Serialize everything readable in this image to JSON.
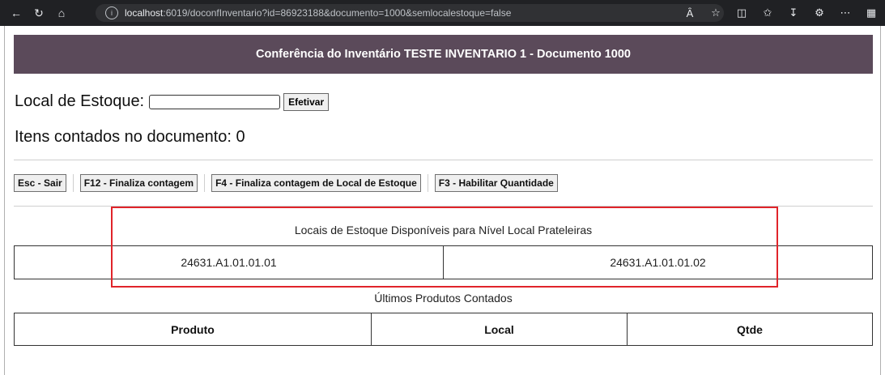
{
  "browser": {
    "url_host": "localhost",
    "url_rest": ":6019/doconfInventario?id=86923188&documento=1000&semlocalestoque=false",
    "icons": [
      "back-icon",
      "refresh-icon",
      "home-icon",
      "info-icon",
      "read-aloud-icon",
      "favorite-star-icon",
      "split-screen-icon",
      "favorites-icon",
      "download-icon",
      "extensions-icon",
      "more-icon",
      "sidebar-icon"
    ]
  },
  "header": {
    "title": "Conferência do Inventário TESTE INVENTARIO 1 - Documento 1000"
  },
  "local": {
    "label": "Local de Estoque:",
    "input_value": "",
    "efetivar_label": "Efetivar"
  },
  "itens": {
    "text": "Itens contados no documento: 0"
  },
  "actions": [
    {
      "label": "Esc - Sair"
    },
    {
      "label": "F12 - Finaliza contagem"
    },
    {
      "label": "F4 - Finaliza contagem de Local de Estoque"
    },
    {
      "label": "F3 - Habilitar Quantidade"
    }
  ],
  "locais": {
    "title": "Locais de Estoque Disponíveis para Nível Local Prateleiras",
    "items": [
      "24631.A1.01.01.01",
      "24631.A1.01.01.02"
    ]
  },
  "ultimos": {
    "title": "Últimos Produtos Contados",
    "columns": [
      "Produto",
      "Local",
      "Qtde"
    ]
  },
  "colors": {
    "header_bg": "#5b4a5a",
    "highlight": "#e0242a"
  }
}
